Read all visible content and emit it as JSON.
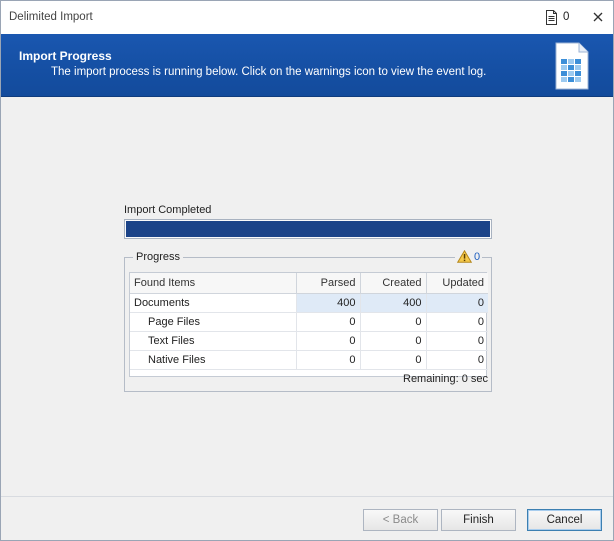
{
  "window": {
    "title": "Delimited Import",
    "event_count": "0"
  },
  "header": {
    "title": "Import Progress",
    "subtitle": "The import process is running below. Click on the warnings icon to view the event log."
  },
  "status": {
    "label": "Import Completed",
    "progress_percent": 100
  },
  "progress_group": {
    "legend": "Progress",
    "warning_count": "0",
    "columns": [
      "Found Items",
      "Parsed",
      "Created",
      "Updated"
    ],
    "rows": [
      {
        "name": "Documents",
        "parsed": "400",
        "created": "400",
        "updated": "0"
      },
      {
        "name": "Page Files",
        "parsed": "0",
        "created": "0",
        "updated": "0"
      },
      {
        "name": "Text Files",
        "parsed": "0",
        "created": "0",
        "updated": "0"
      },
      {
        "name": "Native Files",
        "parsed": "0",
        "created": "0",
        "updated": "0"
      }
    ],
    "remaining": "Remaining: 0 sec"
  },
  "buttons": {
    "back": "< Back",
    "finish": "Finish",
    "cancel": "Cancel"
  },
  "colors": {
    "banner": "#154fa3",
    "progress_fill": "#1b4388",
    "highlight": "#dfeaf7"
  }
}
